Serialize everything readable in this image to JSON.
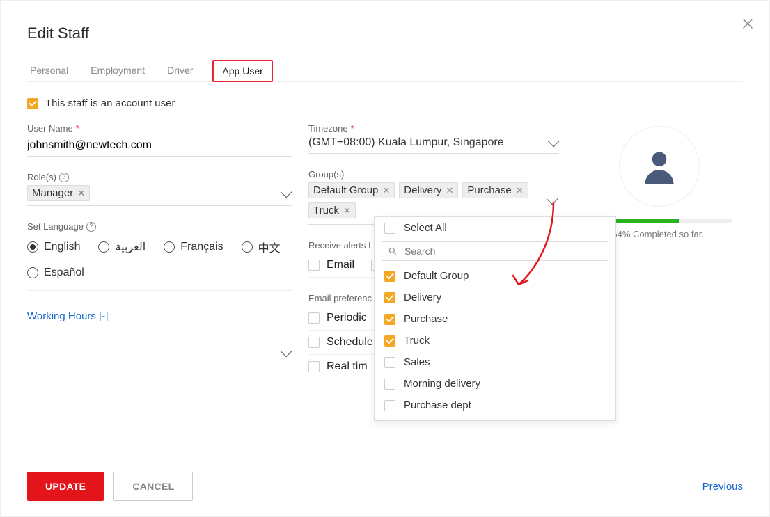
{
  "title": "Edit Staff",
  "tabs": [
    "Personal",
    "Employment",
    "Driver",
    "App User"
  ],
  "active_tab_index": 3,
  "account_user_checkbox": {
    "checked": true,
    "label": "This staff is an account user"
  },
  "username": {
    "label": "User Name",
    "value": "johnsmith@newtech.com"
  },
  "timezone": {
    "label": "Timezone",
    "value": "(GMT+08:00) Kuala Lumpur, Singapore"
  },
  "roles": {
    "label": "Role(s)",
    "chips": [
      "Manager"
    ]
  },
  "groups": {
    "label": "Group(s)",
    "chips": [
      "Default Group",
      "Delivery",
      "Purchase",
      "Truck"
    ]
  },
  "language": {
    "label": "Set Language",
    "options": [
      "English",
      "العربية",
      "Français",
      "中文",
      "Español"
    ],
    "selected_index": 0
  },
  "alerts": {
    "label": "Receive alerts I",
    "options": [
      "Email"
    ]
  },
  "email_prefs": {
    "label": "Email preferenc",
    "items": [
      "Periodic",
      "Schedule",
      "Real tim"
    ]
  },
  "working_hours_link": "Working Hours [-]",
  "progress": {
    "percent": 64,
    "text": "64%  Completed so far.."
  },
  "dropdown": {
    "select_all_label": "Select All",
    "search_placeholder": "Search",
    "items": [
      {
        "label": "Default Group",
        "checked": true
      },
      {
        "label": "Delivery",
        "checked": true
      },
      {
        "label": "Purchase",
        "checked": true
      },
      {
        "label": "Truck",
        "checked": true
      },
      {
        "label": "Sales",
        "checked": false
      },
      {
        "label": "Morning delivery",
        "checked": false
      },
      {
        "label": "Purchase dept",
        "checked": false
      }
    ]
  },
  "footer": {
    "update": "UPDATE",
    "cancel": "CANCEL",
    "previous": "Previous"
  }
}
